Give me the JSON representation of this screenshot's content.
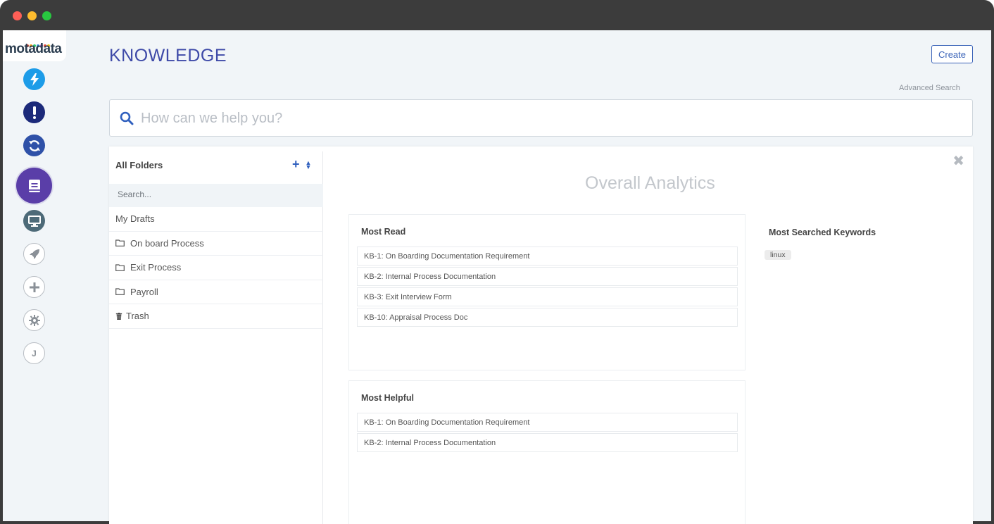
{
  "brand": {
    "logo_text": "motadata",
    "dot_colors": [
      "#e84c3d",
      "#f39c12",
      "#2ecc71",
      "#3498db",
      "#9b59b6",
      "#e84c3d",
      "#f1c40f"
    ]
  },
  "sidebar": {
    "items": [
      {
        "name": "incident",
        "icon": "lightning-icon",
        "color": "#1d9ce8",
        "style": "solid"
      },
      {
        "name": "problem",
        "icon": "exclamation-icon",
        "color": "#1c2a7a",
        "style": "solid"
      },
      {
        "name": "change",
        "icon": "refresh-icon",
        "color": "#2f51a8",
        "style": "solid"
      },
      {
        "name": "knowledge",
        "icon": "book-icon",
        "color": "#5a3ea8",
        "style": "active"
      },
      {
        "name": "asset",
        "icon": "monitor-icon",
        "color": "#4d6a78",
        "style": "solid"
      },
      {
        "name": "release",
        "icon": "rocket-icon",
        "color": "#8a9097",
        "style": "outline"
      },
      {
        "name": "add",
        "icon": "plus-icon",
        "color": "#8a9097",
        "style": "outline"
      },
      {
        "name": "settings",
        "icon": "gear-icon",
        "color": "#8a9097",
        "style": "outline"
      },
      {
        "name": "user",
        "icon": "user-initial-icon",
        "label": "J",
        "color": "#8a9097",
        "style": "outline"
      }
    ]
  },
  "header": {
    "title": "KNOWLEDGE",
    "create_label": "Create",
    "advanced_search": "Advanced Search",
    "search_placeholder": "How can we help you?"
  },
  "folders": {
    "heading": "All Folders",
    "search_placeholder": "Search...",
    "items": [
      {
        "label": "My Drafts",
        "icon": "none"
      },
      {
        "label": "On board Process",
        "icon": "folder-icon"
      },
      {
        "label": "Exit Process",
        "icon": "folder-icon"
      },
      {
        "label": "Payroll",
        "icon": "folder-icon"
      },
      {
        "label": "Trash",
        "icon": "trash-icon"
      }
    ]
  },
  "analytics": {
    "title": "Overall Analytics",
    "most_read": {
      "title": "Most Read",
      "items": [
        "KB-1: On Boarding Documentation Requirement",
        "KB-2: Internal Process Documentation",
        "KB-3: Exit Interview Form",
        "KB-10: Appraisal Process Doc"
      ]
    },
    "most_helpful": {
      "title": "Most Helpful",
      "items": [
        "KB-1: On Boarding Documentation Requirement",
        "KB-2: Internal Process Documentation"
      ]
    },
    "keywords": {
      "title": "Most Searched Keywords",
      "tags": [
        "linux"
      ]
    }
  },
  "colors": {
    "accent": "#3a63b8",
    "title": "#3e4aa8",
    "background": "#f1f5f8"
  }
}
